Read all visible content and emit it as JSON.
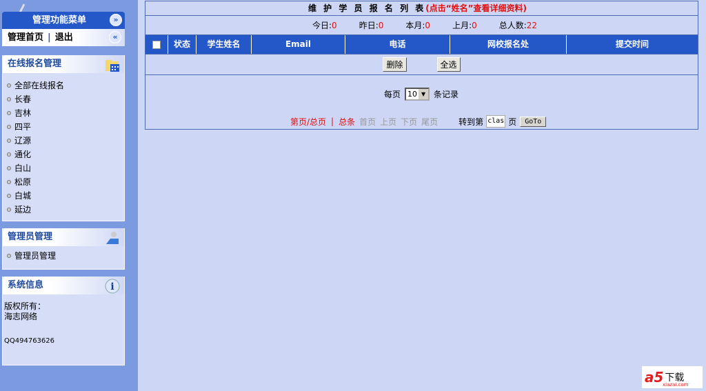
{
  "sidebar": {
    "title": "管理功能菜单",
    "home": "管理首页",
    "logout": "退出",
    "panels": [
      {
        "title": "在线报名管理",
        "icon": "calendar-folder-icon",
        "items": [
          "全部在线报名",
          "长春",
          "吉林",
          "四平",
          "辽源",
          "通化",
          "白山",
          "松原",
          "白城",
          "延边"
        ]
      },
      {
        "title": "管理员管理",
        "icon": "admin-user-icon",
        "items": [
          "管理员管理"
        ]
      },
      {
        "title": "系统信息",
        "icon": "info-icon",
        "lines": [
          "版权所有：",
          "海志网络",
          "QQ494763626"
        ]
      }
    ]
  },
  "main": {
    "title": "维 护 学 员 报 名 列 表",
    "title_hint": "(点击“姓名”查看详细资料)",
    "stats": [
      {
        "label": "今日:",
        "value": "0"
      },
      {
        "label": "昨日:",
        "value": "0"
      },
      {
        "label": "本月:",
        "value": "0"
      },
      {
        "label": "上月:",
        "value": "0"
      },
      {
        "label": "总人数:",
        "value": "22"
      }
    ],
    "columns": [
      "状态",
      "学生姓名",
      "Email",
      "电话",
      "网校报名处",
      "提交时间"
    ],
    "delete_label": "删除",
    "select_all_label": "全选",
    "per_page_label": "每页",
    "per_page_value": "10",
    "records_label": "条记录",
    "page_info": "第页/总页",
    "sep": "|",
    "total": "总条",
    "nav": [
      "首页",
      "上页",
      "下页",
      "尾页"
    ],
    "goto_label": "转到第",
    "goto_value": "clas",
    "page_unit": "页",
    "goto_button": "GoTo"
  },
  "watermark": {
    "text": "a5",
    "suffix": "下载",
    "domain": "xiazai.com"
  },
  "colors": {
    "accent": "#2458c8",
    "sidebar": "#7c9ae0",
    "background": "#cdd6f5",
    "highlight": "#e01010"
  }
}
